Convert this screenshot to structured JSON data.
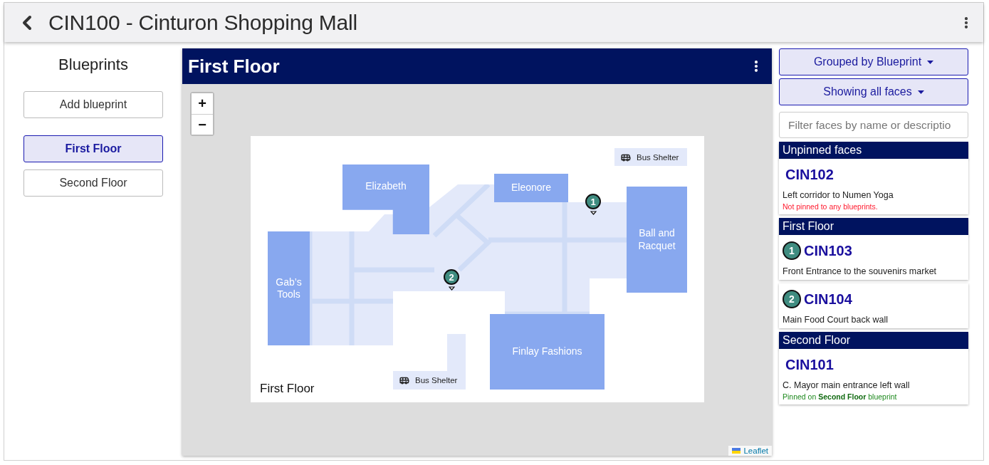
{
  "header": {
    "title": "CIN100 - Cinturon Shopping Mall"
  },
  "sidebar": {
    "title": "Blueprints",
    "add_button": "Add blueprint",
    "blueprints": [
      {
        "name": "First Floor",
        "selected": true
      },
      {
        "name": "Second Floor",
        "selected": false
      }
    ]
  },
  "map_panel": {
    "title": "First Floor",
    "zoom_in": "+",
    "zoom_out": "−",
    "plan": {
      "rooms": [
        {
          "name": "Elizabeth"
        },
        {
          "name": "Eleonore"
        },
        {
          "name": "Ball and Racquet"
        },
        {
          "name": "Gab’s Tools"
        },
        {
          "name": "Finlay Fashions"
        }
      ],
      "bus_shelters": [
        "Bus Shelter",
        "Bus Shelter"
      ],
      "caption": "First Floor"
    },
    "pins": [
      {
        "label": "1"
      },
      {
        "label": "2"
      }
    ],
    "attribution": "Leaflet"
  },
  "faces_panel": {
    "group_menu": "Grouped by Blueprint",
    "filter_menu": "Showing all faces",
    "filter": {
      "placeholder": "Filter faces by name or descriptio"
    },
    "groups": [
      {
        "title": "Unpinned faces",
        "faces": [
          {
            "code": "CIN102",
            "description": "Left corridor to Numen Yoga",
            "status": "Not pinned to any blueprints.",
            "pinned": false
          }
        ]
      },
      {
        "title": "First Floor",
        "faces": [
          {
            "pin": "1",
            "code": "CIN103",
            "description": "Front Entrance to the souvenirs market"
          },
          {
            "pin": "2",
            "code": "CIN104",
            "description": "Main Food Court back wall"
          }
        ]
      },
      {
        "title": "Second Floor",
        "faces": [
          {
            "code": "CIN101",
            "description": "C. Mayor main entrance left wall",
            "status": "Pinned on **Second Floor** blueprint",
            "pinned": true
          }
        ]
      }
    ]
  }
}
